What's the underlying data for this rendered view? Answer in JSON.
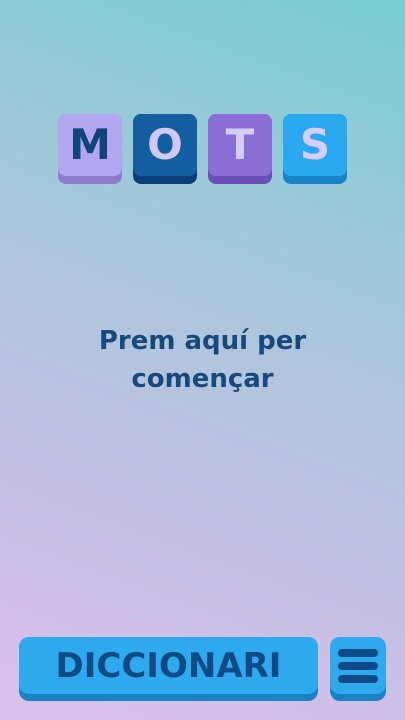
{
  "logo": {
    "letters": [
      "M",
      "O",
      "T",
      "S"
    ]
  },
  "start_prompt": {
    "line1": "Prem aquí per",
    "line2": "començar"
  },
  "bottom_bar": {
    "dictionary_label": "DICCIONARI",
    "menu_icon": "hamburger-menu-icon"
  },
  "colors": {
    "background_top": "#77cfcf",
    "background_bottom": "#dcc0ec",
    "accent_blue": "#2ea9ee",
    "text_navy": "#17497a"
  }
}
